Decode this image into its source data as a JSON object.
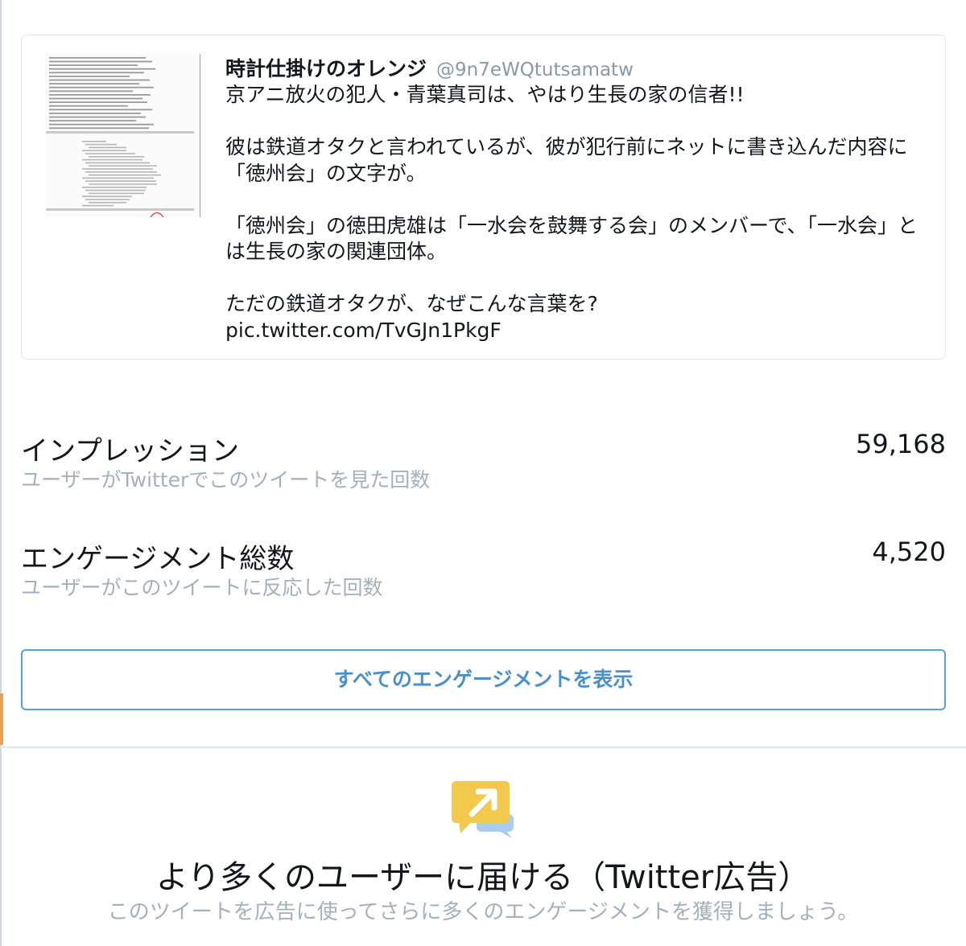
{
  "tweet": {
    "author_name": "時計仕掛けのオレンジ",
    "author_handle": "@9n7eWQtutsamatw",
    "text": "京アニ放火の犯人・青葉真司は、やはり生長の家の信者!!\n\n彼は鉄道オタクと言われているが、彼が犯行前にネットに書き込んだ内容に「徳州会」の文字が。\n\n「徳州会」の徳田虎雄は「一水会を鼓舞する会」のメンバーで、「一水会」とは生長の家の関連団体。\n\nただの鉄道オタクが、なぜこんな言葉を?\npic.twitter.com/TvGJn1PkgF"
  },
  "metrics": [
    {
      "title": "インプレッション",
      "description": "ユーザーがTwitterでこのツイートを見た回数",
      "value": "59,168"
    },
    {
      "title": "エンゲージメント総数",
      "description": "ユーザーがこのツイートに反応した回数",
      "value": "4,520"
    }
  ],
  "engagements_button": {
    "label": "すべてのエンゲージメントを表示"
  },
  "promote": {
    "title": "より多くのユーザーに届ける（Twitter広告）",
    "description": "このツイートを広告に使ってさらに多くのエンゲージメントを獲得しましょう。",
    "icon": "promote-arrow-speech-bubble-icon"
  },
  "colors": {
    "accent": "#4a90c9",
    "icon_yellow": "#f2c94c",
    "icon_blue": "#a9cdea",
    "muted_text": "#a4b0bb"
  }
}
